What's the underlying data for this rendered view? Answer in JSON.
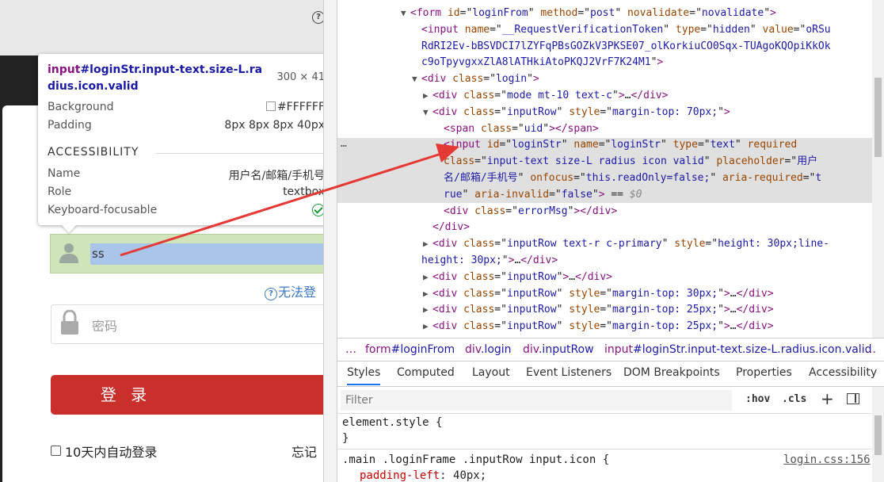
{
  "tooltip": {
    "tag": "input",
    "selector_rest": "#loginStr.input-text.size-L.radius.icon.valid",
    "dimensions": "300 × 41",
    "background_label": "Background",
    "background_value": "#FFFFFF",
    "padding_label": "Padding",
    "padding_value": "8px 8px 8px 40px",
    "section_title": "ACCESSIBILITY",
    "name_label": "Name",
    "name_value": "用户名/邮箱/手机号",
    "role_label": "Role",
    "role_value": "textbox",
    "focusable_label": "Keyboard-focusable"
  },
  "login_page": {
    "help_icon": "?",
    "username_value": "ss",
    "cant_login_text": "无法登",
    "password_placeholder": "密码",
    "login_button": "登 录",
    "remember_label": "10天内自动登录",
    "forgot_label": "忘记"
  },
  "dom": {
    "lines": [
      {
        "indent": 0,
        "tri": "▼",
        "parts": [
          [
            "tg",
            "<form "
          ],
          [
            "an",
            "id"
          ],
          [
            "tx",
            "=\""
          ],
          [
            "av",
            "loginFrom"
          ],
          [
            "tx",
            "\" "
          ],
          [
            "an",
            "method"
          ],
          [
            "tx",
            "=\""
          ],
          [
            "av",
            "post"
          ],
          [
            "tx",
            "\" "
          ],
          [
            "an",
            "novalidate"
          ],
          [
            "tx",
            "=\""
          ],
          [
            "av",
            "novalidate"
          ],
          [
            "tx",
            "\""
          ],
          [
            "tg",
            ">"
          ]
        ]
      },
      {
        "indent": 1,
        "tri": "",
        "parts": [
          [
            "tg",
            "<input "
          ],
          [
            "an",
            "name"
          ],
          [
            "tx",
            "=\""
          ],
          [
            "av",
            "__RequestVerificationToken"
          ],
          [
            "tx",
            "\" "
          ],
          [
            "an",
            "type"
          ],
          [
            "tx",
            "=\""
          ],
          [
            "av",
            "hidden"
          ],
          [
            "tx",
            "\" "
          ],
          [
            "an",
            "value"
          ],
          [
            "tx",
            "=\""
          ],
          [
            "av",
            "oRSu"
          ]
        ]
      },
      {
        "indent": 1,
        "tri": "",
        "parts": [
          [
            "av",
            "RdRI2Ev-bBSVDCI7lZYFqPBsGOZkV3PKSE07_olKorkiuCO0Sqx-TUAgoKQOpiKkOk"
          ]
        ]
      },
      {
        "indent": 1,
        "tri": "",
        "parts": [
          [
            "av",
            "c9oTpyvgxxZlA8lATHkiAtoPKQJ2VrF7K24M1"
          ],
          [
            "tx",
            "\""
          ],
          [
            "tg",
            ">"
          ]
        ]
      },
      {
        "indent": 1,
        "tri": "▼",
        "parts": [
          [
            "tg",
            "<div "
          ],
          [
            "an",
            "class"
          ],
          [
            "tx",
            "=\""
          ],
          [
            "av",
            "login"
          ],
          [
            "tx",
            "\""
          ],
          [
            "tg",
            ">"
          ]
        ]
      },
      {
        "indent": 2,
        "tri": "▶",
        "parts": [
          [
            "tg",
            "<div "
          ],
          [
            "an",
            "class"
          ],
          [
            "tx",
            "=\""
          ],
          [
            "av",
            "mode mt-10 text-c"
          ],
          [
            "tx",
            "\""
          ],
          [
            "tg",
            ">"
          ],
          [
            "tx",
            "…"
          ],
          [
            "tg",
            "</div>"
          ]
        ]
      },
      {
        "indent": 2,
        "tri": "▼",
        "parts": [
          [
            "tg",
            "<div "
          ],
          [
            "an",
            "class"
          ],
          [
            "tx",
            "=\""
          ],
          [
            "av",
            "inputRow"
          ],
          [
            "tx",
            "\" "
          ],
          [
            "an",
            "style"
          ],
          [
            "tx",
            "=\""
          ],
          [
            "av",
            "margin-top: 70px;"
          ],
          [
            "tx",
            "\""
          ],
          [
            "tg",
            ">"
          ]
        ]
      },
      {
        "indent": 3,
        "tri": "",
        "parts": [
          [
            "tg",
            "<span "
          ],
          [
            "an",
            "class"
          ],
          [
            "tx",
            "=\""
          ],
          [
            "av",
            "uid"
          ],
          [
            "tx",
            "\""
          ],
          [
            "tg",
            "></span>"
          ]
        ]
      },
      {
        "indent": 3,
        "tri": "",
        "parts": [
          [
            "tg",
            "<input "
          ],
          [
            "an",
            "id"
          ],
          [
            "tx",
            "=\""
          ],
          [
            "av",
            "loginStr"
          ],
          [
            "tx",
            "\" "
          ],
          [
            "an",
            "name"
          ],
          [
            "tx",
            "=\""
          ],
          [
            "av",
            "loginStr"
          ],
          [
            "tx",
            "\" "
          ],
          [
            "an",
            "type"
          ],
          [
            "tx",
            "=\""
          ],
          [
            "av",
            "text"
          ],
          [
            "tx",
            "\" "
          ],
          [
            "an",
            "required"
          ]
        ]
      },
      {
        "indent": 3,
        "tri": "",
        "parts": [
          [
            "an",
            "class"
          ],
          [
            "tx",
            "=\""
          ],
          [
            "av",
            "input-text size-L radius icon valid"
          ],
          [
            "tx",
            "\" "
          ],
          [
            "an",
            "placeholder"
          ],
          [
            "tx",
            "=\""
          ],
          [
            "av",
            "用户"
          ]
        ]
      },
      {
        "indent": 3,
        "tri": "",
        "parts": [
          [
            "av",
            "名/邮箱/手机号"
          ],
          [
            "tx",
            "\" "
          ],
          [
            "an",
            "onfocus"
          ],
          [
            "tx",
            "=\""
          ],
          [
            "av",
            "this.readOnly=false;"
          ],
          [
            "tx",
            "\" "
          ],
          [
            "an",
            "aria-required"
          ],
          [
            "tx",
            "=\""
          ],
          [
            "av",
            "t"
          ]
        ]
      },
      {
        "indent": 3,
        "tri": "",
        "parts": [
          [
            "av",
            "rue"
          ],
          [
            "tx",
            "\" "
          ],
          [
            "an",
            "aria-invalid"
          ],
          [
            "tx",
            "=\""
          ],
          [
            "av",
            "false"
          ],
          [
            "tx",
            "\""
          ],
          [
            "tg",
            ">"
          ],
          [
            "tx",
            " == "
          ],
          [
            "gr",
            "$0"
          ]
        ]
      },
      {
        "indent": 3,
        "tri": "",
        "parts": [
          [
            "tg",
            "<div "
          ],
          [
            "an",
            "class"
          ],
          [
            "tx",
            "=\""
          ],
          [
            "av",
            "errorMsg"
          ],
          [
            "tx",
            "\""
          ],
          [
            "tg",
            "></div>"
          ]
        ]
      },
      {
        "indent": 2,
        "tri": "",
        "parts": [
          [
            "tg",
            "</div>"
          ]
        ]
      },
      {
        "indent": 2,
        "tri": "▶",
        "parts": [
          [
            "tg",
            "<div "
          ],
          [
            "an",
            "class"
          ],
          [
            "tx",
            "=\""
          ],
          [
            "av",
            "inputRow text-r c-primary"
          ],
          [
            "tx",
            "\" "
          ],
          [
            "an",
            "style"
          ],
          [
            "tx",
            "=\""
          ],
          [
            "av",
            "height: 30px;line-"
          ]
        ]
      },
      {
        "indent": 1,
        "tri": "",
        "parts": [
          [
            "av",
            "height: 30px;"
          ],
          [
            "tx",
            "\""
          ],
          [
            "tg",
            ">"
          ],
          [
            "tx",
            "…"
          ],
          [
            "tg",
            "</div>"
          ]
        ]
      },
      {
        "indent": 2,
        "tri": "▶",
        "parts": [
          [
            "tg",
            "<div "
          ],
          [
            "an",
            "class"
          ],
          [
            "tx",
            "=\""
          ],
          [
            "av",
            "inputRow"
          ],
          [
            "tx",
            "\""
          ],
          [
            "tg",
            ">"
          ],
          [
            "tx",
            "…"
          ],
          [
            "tg",
            "</div>"
          ]
        ]
      },
      {
        "indent": 2,
        "tri": "▶",
        "parts": [
          [
            "tg",
            "<div "
          ],
          [
            "an",
            "class"
          ],
          [
            "tx",
            "=\""
          ],
          [
            "av",
            "inputRow"
          ],
          [
            "tx",
            "\" "
          ],
          [
            "an",
            "style"
          ],
          [
            "tx",
            "=\""
          ],
          [
            "av",
            "margin-top: 30px;"
          ],
          [
            "tx",
            "\""
          ],
          [
            "tg",
            ">"
          ],
          [
            "tx",
            "…"
          ],
          [
            "tg",
            "</div>"
          ]
        ]
      },
      {
        "indent": 2,
        "tri": "▶",
        "parts": [
          [
            "tg",
            "<div "
          ],
          [
            "an",
            "class"
          ],
          [
            "tx",
            "=\""
          ],
          [
            "av",
            "inputRow"
          ],
          [
            "tx",
            "\" "
          ],
          [
            "an",
            "style"
          ],
          [
            "tx",
            "=\""
          ],
          [
            "av",
            "margin-top: 25px;"
          ],
          [
            "tx",
            "\""
          ],
          [
            "tg",
            ">"
          ],
          [
            "tx",
            "…"
          ],
          [
            "tg",
            "</div>"
          ]
        ]
      },
      {
        "indent": 2,
        "tri": "▶",
        "parts": [
          [
            "tg",
            "<div "
          ],
          [
            "an",
            "class"
          ],
          [
            "tx",
            "=\""
          ],
          [
            "av",
            "inputRow"
          ],
          [
            "tx",
            "\" "
          ],
          [
            "an",
            "style"
          ],
          [
            "tx",
            "=\""
          ],
          [
            "av",
            "margin-top: 25px;"
          ],
          [
            "tx",
            "\""
          ],
          [
            "tg",
            ">"
          ],
          [
            "tx",
            "…"
          ],
          [
            "tg",
            "</div>"
          ]
        ]
      }
    ],
    "more_dots": "…"
  },
  "breadcrumbs": [
    {
      "tag": "…",
      "rest": ""
    },
    {
      "tag": "form",
      "rest": "#loginFrom"
    },
    {
      "tag": "div",
      "rest": ".login"
    },
    {
      "tag": "div",
      "rest": ".inputRow"
    },
    {
      "tag": "input",
      "rest": "#loginStr.input-text.size-L.radius.icon.valid"
    },
    {
      "tag": "…",
      "rest": ""
    }
  ],
  "panel_tabs": [
    "Styles",
    "Computed",
    "Layout",
    "Event Listeners",
    "DOM Breakpoints",
    "Properties",
    "Accessibility"
  ],
  "filter": {
    "placeholder": "Filter",
    "hov": ":hov",
    "cls": ".cls",
    "plus": "+"
  },
  "styles": {
    "element_style_open": "element.style {",
    "element_style_close": "}",
    "rule_selector": ".main .loginFrame .inputRow input.icon {",
    "rule_source": "login.css:156",
    "rule_prop": "padding-left",
    "rule_value": "40px;"
  },
  "colors": {
    "arrow": "#e53935",
    "tag": "#881280",
    "attr_name": "#994500",
    "attr_value": "#1a1aa6",
    "login_button": "#c9302c"
  }
}
